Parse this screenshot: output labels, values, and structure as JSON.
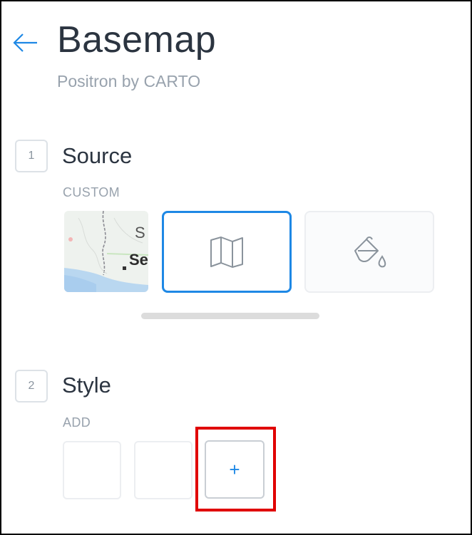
{
  "header": {
    "title": "Basemap",
    "subtitle": "Positron by CARTO",
    "back_icon": "arrow-left-icon",
    "accent_color": "#1e88e5"
  },
  "source_step": {
    "number": "1",
    "title": "Source",
    "caption": "CUSTOM",
    "thumbnail_text": "Se",
    "thumbnail_text_partial": "S",
    "tiles": [
      {
        "icon": "map-icon",
        "selected": true
      },
      {
        "icon": "paint-bucket-icon",
        "selected": false
      }
    ]
  },
  "style_step": {
    "number": "2",
    "title": "Style",
    "caption": "ADD",
    "add_label": "+",
    "highlight_color": "#e00000"
  }
}
